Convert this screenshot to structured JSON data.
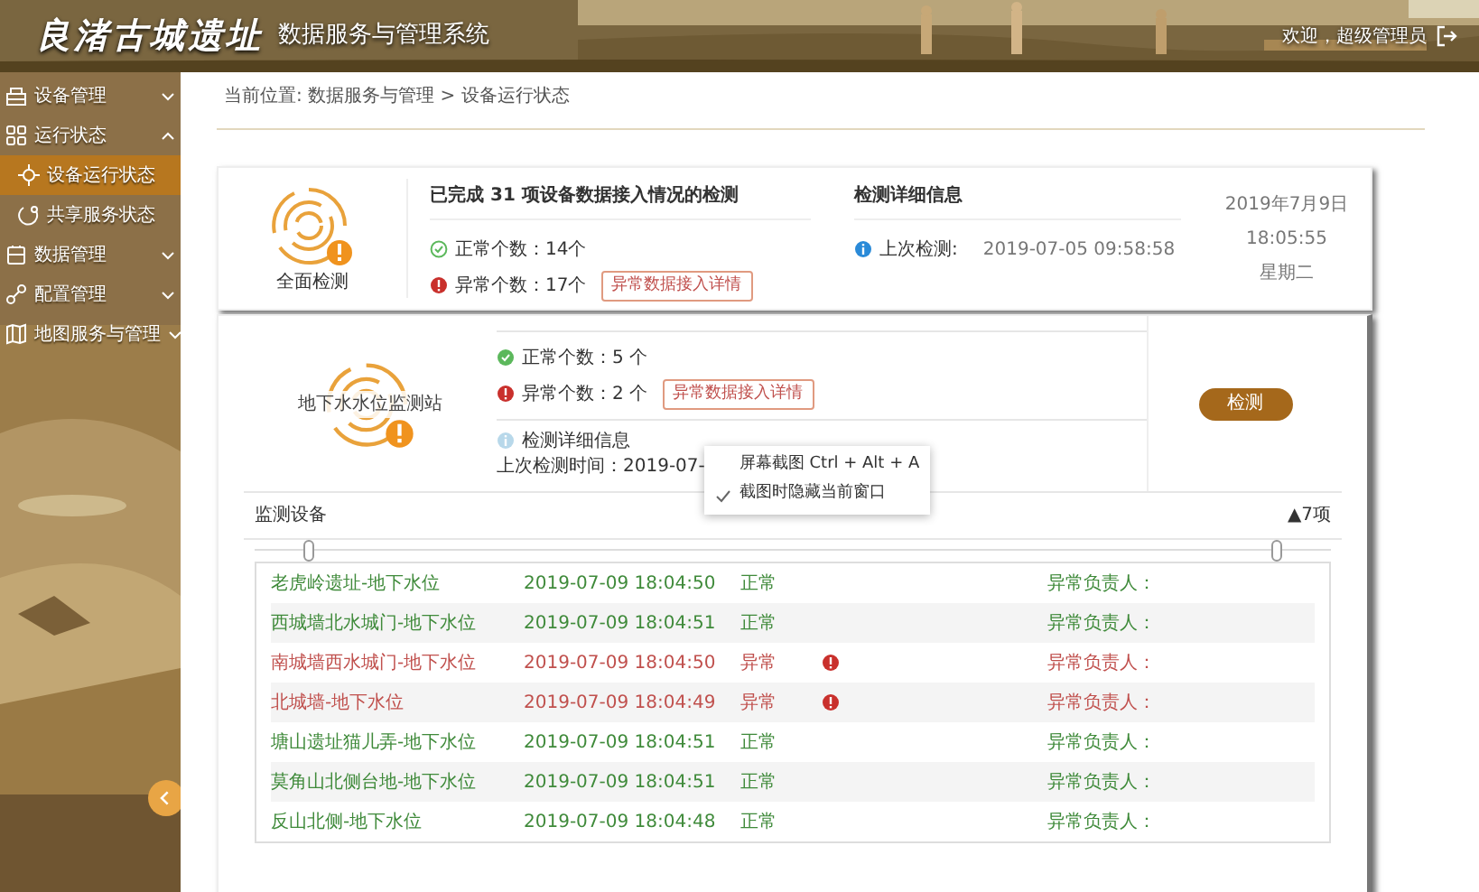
{
  "header": {
    "logo": "良渚古城遗址",
    "title": "数据服务与管理系统",
    "welcome": "欢迎，超级管理员"
  },
  "sidebar": {
    "items": [
      {
        "label": "设备管理",
        "expanded": false
      },
      {
        "label": "运行状态",
        "expanded": true,
        "children": [
          {
            "label": "设备运行状态",
            "selected": true
          },
          {
            "label": "共享服务状态",
            "selected": false
          }
        ]
      },
      {
        "label": "数据管理",
        "expanded": false
      },
      {
        "label": "配置管理",
        "expanded": false
      },
      {
        "label": "地图服务与管理",
        "expanded": false
      }
    ]
  },
  "breadcrumb": "当前位置: 数据服务与管理 > 设备运行状态",
  "summary": {
    "icon_label": "全面检测",
    "title": "已完成 31 项设备数据接入情况的检测",
    "normal": "正常个数：14个",
    "abnormal": "异常个数：17个",
    "detail_button": "异常数据接入详情",
    "detail_title": "检测详细信息",
    "last_label": "上次检测:",
    "last_time": "2019-07-05 09:58:58",
    "date": "2019年7月9日",
    "time": "18:05:55",
    "weekday": "星期二"
  },
  "station": {
    "name": "地下水水位监测站",
    "normal": "正常个数：5 个",
    "abnormal": "异常个数：2 个",
    "detail_button": "异常数据接入详情",
    "detail_title": "检测详细信息",
    "last_check": "上次检测时间：2019-07-",
    "check_button": "检测"
  },
  "context_menu": [
    {
      "label": "屏幕截图",
      "shortcut": "Ctrl + Alt + A",
      "checked": false
    },
    {
      "label": "截图时隐藏当前窗口",
      "checked": true
    }
  ],
  "devices": {
    "title": "监测设备",
    "count": "▲7项",
    "rows": [
      {
        "name": "老虎岭遗址-地下水位",
        "time": "2019-07-09 18:04:50",
        "status": "正常",
        "abnormal": false,
        "owner": "异常负责人："
      },
      {
        "name": "西城墙北水城门-地下水位",
        "time": "2019-07-09 18:04:51",
        "status": "正常",
        "abnormal": false,
        "owner": "异常负责人："
      },
      {
        "name": "南城墙西水城门-地下水位",
        "time": "2019-07-09 18:04:50",
        "status": "异常",
        "abnormal": true,
        "owner": "异常负责人："
      },
      {
        "name": "北城墙-地下水位",
        "time": "2019-07-09 18:04:49",
        "status": "异常",
        "abnormal": true,
        "owner": "异常负责人："
      },
      {
        "name": "塘山遗址猫儿弄-地下水位",
        "time": "2019-07-09 18:04:51",
        "status": "正常",
        "abnormal": false,
        "owner": "异常负责人："
      },
      {
        "name": "莫角山北侧台地-地下水位",
        "time": "2019-07-09 18:04:51",
        "status": "正常",
        "abnormal": false,
        "owner": "异常负责人："
      },
      {
        "name": "反山北侧-地下水位",
        "time": "2019-07-09 18:04:48",
        "status": "正常",
        "abnormal": false,
        "owner": "异常负责人："
      }
    ]
  }
}
